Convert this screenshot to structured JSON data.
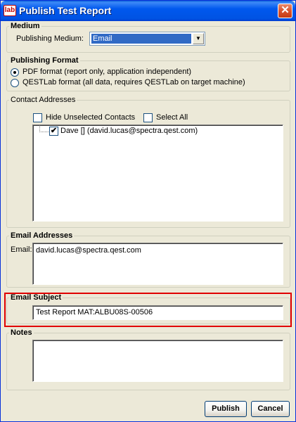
{
  "window": {
    "title": "Publish Test Report",
    "icon_text": "lab",
    "close_glyph": "✕"
  },
  "medium": {
    "legend": "Medium",
    "label": "Publishing Medium:",
    "selected": "Email",
    "dropdown_glyph": "▼"
  },
  "format": {
    "legend": "Publishing Format",
    "options": [
      {
        "label": "PDF format (report only, application independent)",
        "selected": true
      },
      {
        "label": "QESTLab format (all data, requires QESTLab on target machine)",
        "selected": false
      }
    ]
  },
  "contacts": {
    "legend": "Contact Addresses",
    "hide_unselected_label": "Hide Unselected Contacts",
    "select_all_label": "Select All",
    "items": [
      {
        "label": "Dave [] (david.lucas@spectra.qest.com)",
        "checked": true
      }
    ],
    "check_glyph": "✔"
  },
  "email_addresses": {
    "legend": "Email Addresses",
    "label": "Email:",
    "value": "david.lucas@spectra.qest.com"
  },
  "email_subject": {
    "legend": "Email Subject",
    "value": "Test Report MAT:ALBU08S-00506"
  },
  "notes": {
    "legend": "Notes",
    "value": ""
  },
  "buttons": {
    "publish": "Publish",
    "cancel": "Cancel"
  }
}
